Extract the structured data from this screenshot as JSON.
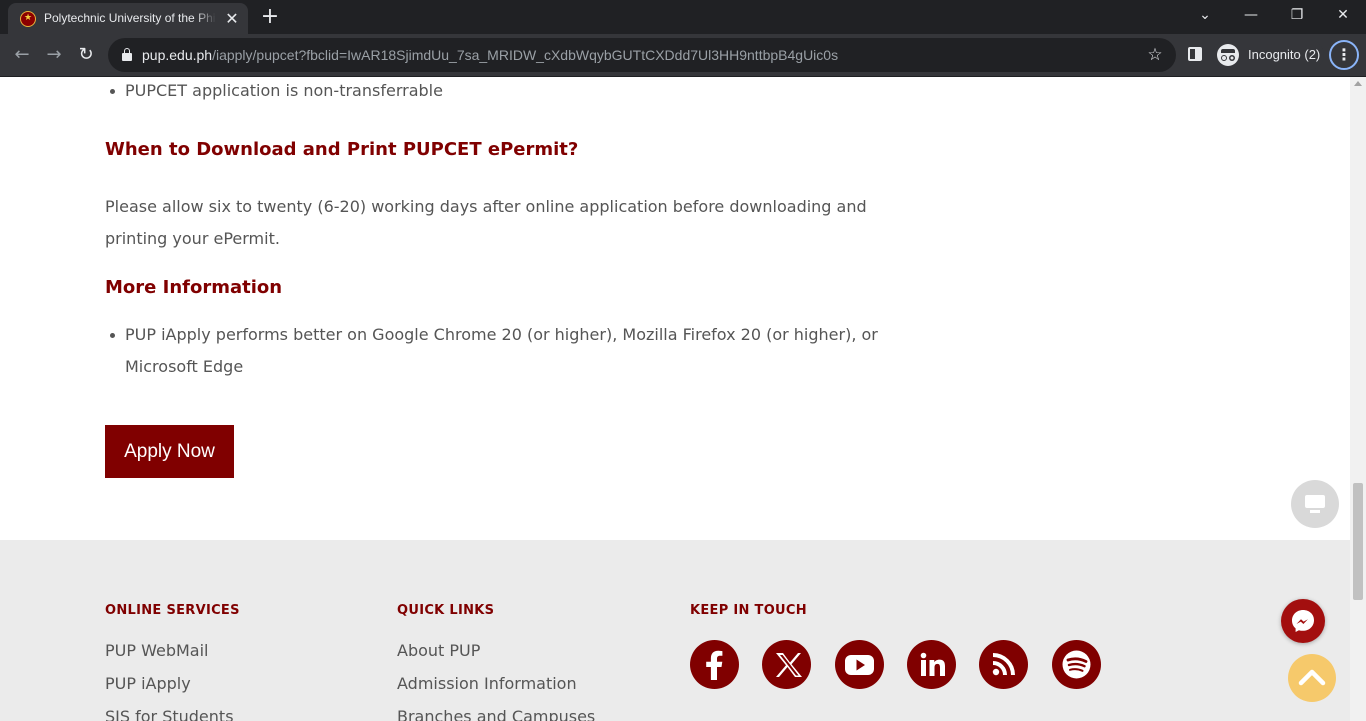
{
  "browser": {
    "tab_title": "Polytechnic University of the Philippines",
    "tab_close": "✕",
    "new_tab": "+",
    "url_host": "pup.edu.ph",
    "url_path": "/iapply/pupcet?fbclid=IwAR18SjimdUu_7sa_MRIDW_cXdbWqybGUTtCXDdd7Ul3HH9nttbpB4gUic0s",
    "incognito_label": "Incognito (2)",
    "icons": [
      "back-icon",
      "forward-icon",
      "reload-icon",
      "lock-icon",
      "star-icon",
      "side-panel-icon",
      "incognito-icon",
      "menu-icon"
    ]
  },
  "content": {
    "bullet_top": "PUPCET application is non-transferrable",
    "heading_download": "When to Download and Print PUPCET ePermit?",
    "para_download": "Please allow six to twenty (6-20) working days after online application before downloading and printing your ePermit.",
    "heading_more": "More Information",
    "bullet_more": "PUP iApply performs better on Google Chrome 20 (or higher), Mozilla Firefox 20 (or higher), or Microsoft Edge",
    "apply_button": "Apply Now"
  },
  "footer": {
    "online_services": {
      "title": "ONLINE SERVICES",
      "links": [
        "PUP WebMail",
        "PUP iApply",
        "SIS for Students"
      ]
    },
    "quick_links": {
      "title": "QUICK LINKS",
      "links": [
        "About PUP",
        "Admission Information",
        "Branches and Campuses"
      ]
    },
    "keep_in_touch": {
      "title": "KEEP IN TOUCH",
      "socials": [
        "facebook-icon",
        "x-icon",
        "youtube-icon",
        "linkedin-icon",
        "rss-icon",
        "spotify-icon"
      ]
    }
  },
  "colors": {
    "brand_maroon": "#800000",
    "footer_bg": "#ebebeb",
    "text_gray": "#555555",
    "scroll_top_fab": "#f6c96b"
  }
}
